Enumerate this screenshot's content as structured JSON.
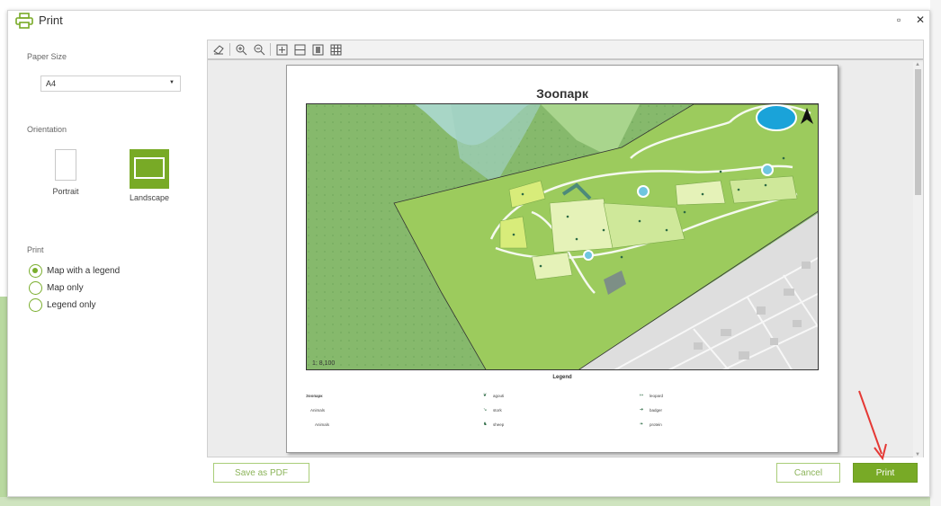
{
  "window": {
    "title": "Print",
    "app_icon": "printer-icon",
    "maximize_icon": "maximize-icon",
    "close_icon": "close-icon",
    "maximize_glyph": "▫",
    "close_glyph": "✕"
  },
  "sidebar": {
    "paper_size_label": "Paper Size",
    "paper_size_value": "A4",
    "orientation_label": "Orientation",
    "portrait_label": "Portrait",
    "landscape_label": "Landscape",
    "orientation_selected": "landscape",
    "print_label": "Print",
    "print_options": [
      {
        "label": "Map with a legend",
        "selected": true
      },
      {
        "label": "Map only",
        "selected": false
      },
      {
        "label": "Legend only",
        "selected": false
      }
    ]
  },
  "preview": {
    "toolbar_icons": [
      "print-preview-icon",
      "zoom-in-icon",
      "zoom-out-icon",
      "fit-page-icon",
      "fit-width-icon",
      "single-page-icon",
      "multi-page-icon"
    ],
    "map_title": "Зоопарк",
    "scale_text": "1: 8,100",
    "legend_title": "Legend",
    "legend_col1": [
      "Зоопарк",
      "Animals",
      "Animals"
    ],
    "legend_col2": [
      "agouti",
      "stork",
      "sheep"
    ],
    "legend_col3": [
      "leopard",
      "badger",
      "protein"
    ]
  },
  "buttons": {
    "save_pdf": "Save as PDF",
    "cancel": "Cancel",
    "print": "Print"
  },
  "colors": {
    "accent": "#78aa26",
    "zoo_green": "#9ccb5d",
    "forest_green": "#83b66a",
    "annotation_arrow": "#e53935"
  }
}
